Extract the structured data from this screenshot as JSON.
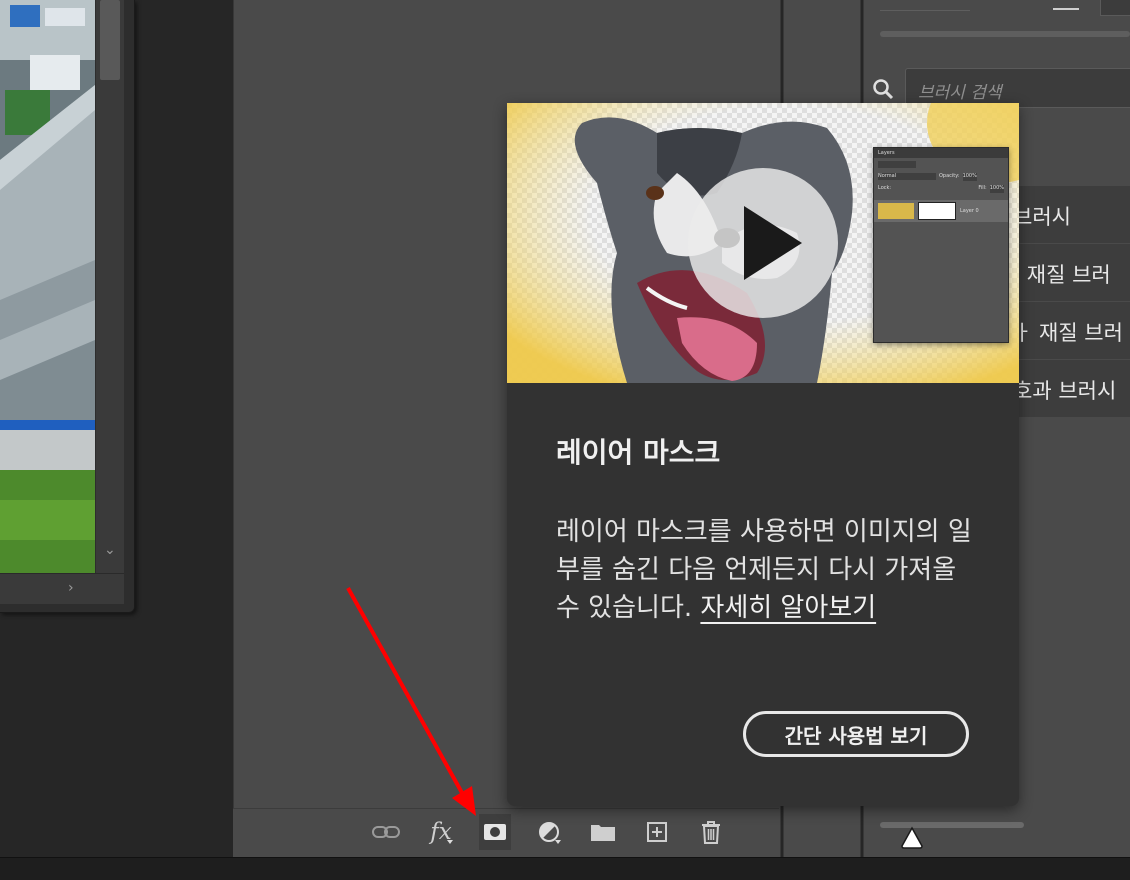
{
  "popup": {
    "title": "레이어 마스크",
    "body": "레이어 마스크를 사용하면 이미지의 일부를 숨긴 다음 언제든지 다시 가져올 수 있습니다.",
    "learn_more_link": "자세히 알아보기",
    "tour_button": "간단 사용법 보기",
    "video_thumbnail": "dog-layer-mask-video",
    "play_icon": "play-icon",
    "mini_panel": {
      "tab": "Layers",
      "blend_mode": "Normal",
      "opacity_label": "Opacity:",
      "opacity_value": "100%",
      "fill_label": "Fill:",
      "fill_value": "100%",
      "lock_label": "Lock:",
      "layer_name": "Layer 0"
    }
  },
  "brush_panel": {
    "search_placeholder": "브러시 검색",
    "items": [
      {
        "label": "브러시"
      },
      {
        "label": "| 재질 브러"
      },
      {
        "label": "ㅏ 재질 브러"
      },
      {
        "label": "호과 브러시"
      }
    ]
  },
  "layers_footer": {
    "tools": [
      {
        "name": "link-layers",
        "icon": "link-icon"
      },
      {
        "name": "layer-style",
        "icon": "fx-icon",
        "label": "fx"
      },
      {
        "name": "add-mask",
        "icon": "mask-icon"
      },
      {
        "name": "adjustment-layer",
        "icon": "adjustment-icon"
      },
      {
        "name": "new-group",
        "icon": "folder-icon"
      },
      {
        "name": "new-layer",
        "icon": "new-layer-icon"
      },
      {
        "name": "delete-layer",
        "icon": "trash-icon"
      }
    ]
  },
  "colors": {
    "panel_bg": "#4a4a4a",
    "popup_bg": "#323232",
    "annotation_arrow": "#ff0000"
  }
}
